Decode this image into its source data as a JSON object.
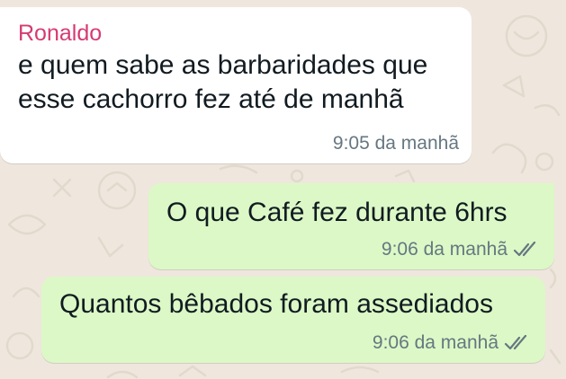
{
  "conversation": {
    "messages": [
      {
        "direction": "incoming",
        "sender": "Ronaldo",
        "text_line1": "e quem sabe as barbaridades que",
        "text_line2": "esse cachorro fez até de manhã",
        "time": "9:05 da manhã"
      },
      {
        "direction": "outgoing",
        "text": "O que Café fez durante 6hrs",
        "time": "9:06 da manhã",
        "status_icon": "double-check-read-icon"
      },
      {
        "direction": "outgoing",
        "text": "Quantos bêbados foram assediados",
        "time": "9:06 da manhã",
        "status_icon": "double-check-read-icon"
      }
    ]
  },
  "theme": {
    "chat_background": "#efe7dd",
    "incoming_bubble": "#ffffff",
    "outgoing_bubble": "#dcf8c6",
    "sender_name_color": "#d63a73",
    "meta_text_color": "#667781",
    "tick_color": "#667781"
  }
}
